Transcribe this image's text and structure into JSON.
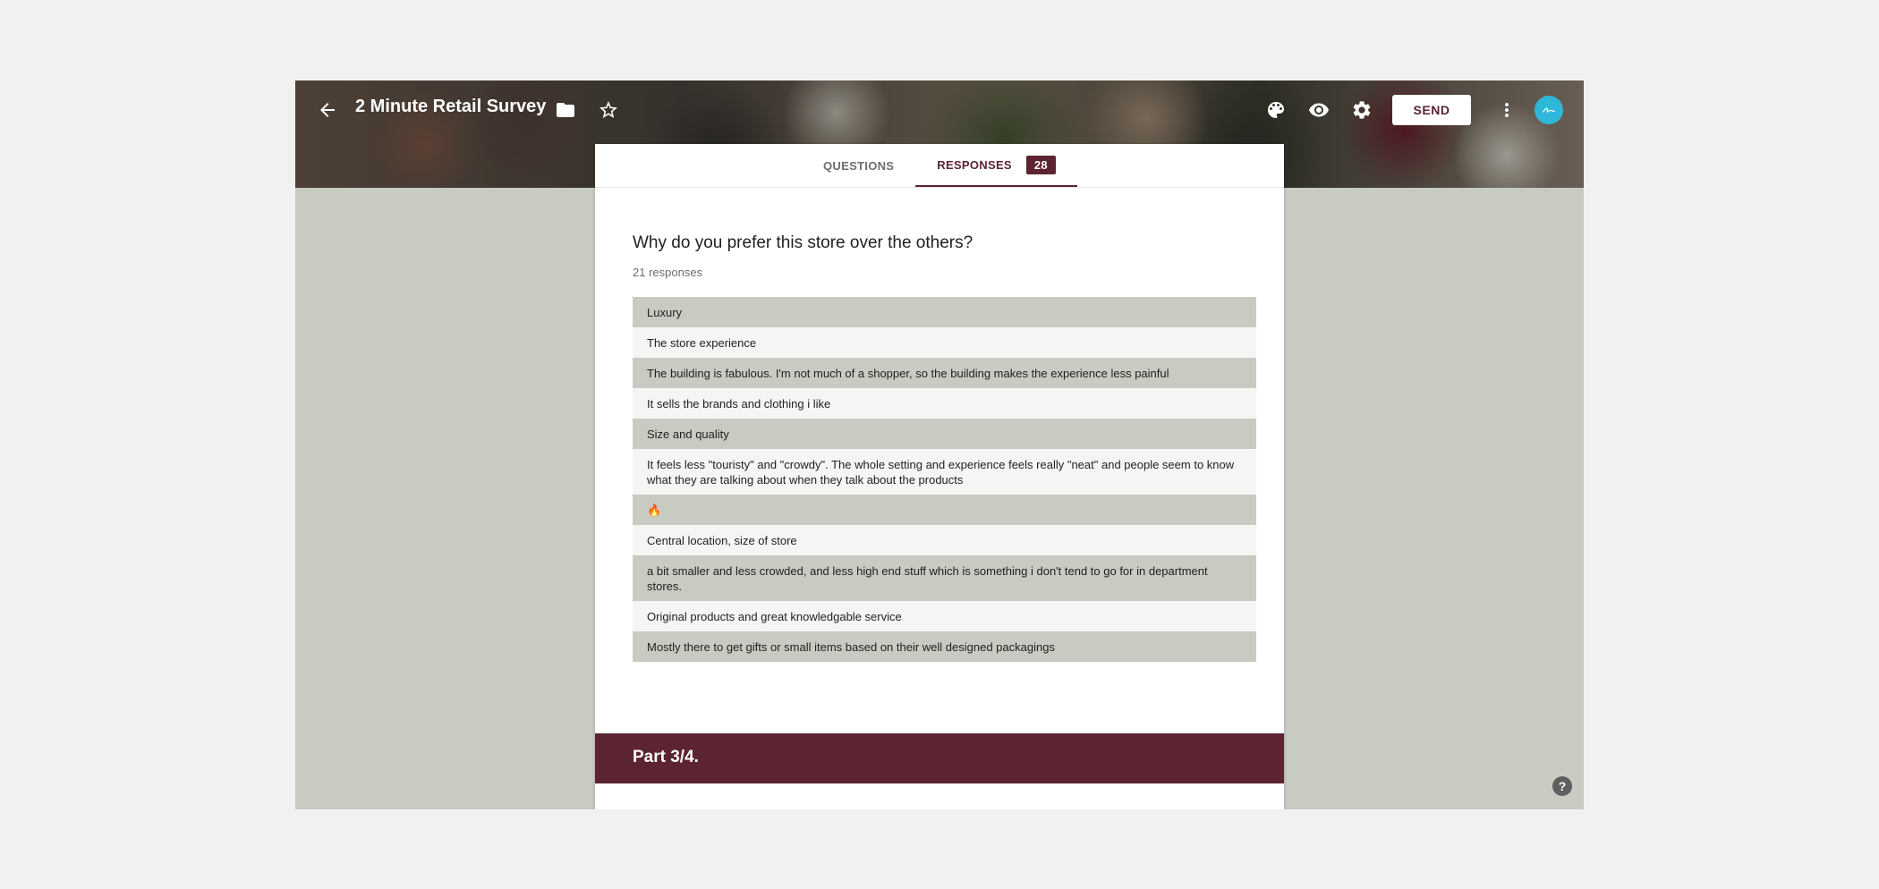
{
  "header": {
    "title": "2 Minute Retail Survey",
    "send_label": "SEND",
    "icons": [
      "back-arrow-icon",
      "folder-icon",
      "star-icon",
      "palette-icon",
      "eye-icon",
      "gear-icon",
      "more-vert-icon"
    ]
  },
  "tabs": {
    "questions_label": "QUESTIONS",
    "responses_label": "RESPONSES",
    "responses_count": "28"
  },
  "question": {
    "title": "Why do you prefer this store over the others?",
    "response_count": "21 responses"
  },
  "responses": [
    "Luxury",
    "The store experience",
    "The building is fabulous. I'm not much of a shopper, so the building makes the experience less painful",
    "It sells the brands and clothing i like",
    "Size and quality",
    "It feels less \"touristy\" and \"crowdy\". The whole setting and experience feels really \"neat\" and people seem to know what they are talking about when they talk about the products",
    "🔥",
    "Central location, size of store",
    "a bit smaller and less crowded, and less high end stuff which is something i don't tend to go for in department stores.",
    "Original products and great knowledgable service",
    "Mostly there to get gifts or small items based on their well designed packagings"
  ],
  "section": {
    "title": "Part 3/4."
  },
  "help": {
    "label": "?"
  },
  "colors": {
    "accent": "#5b2430",
    "background": "#c8cbc2",
    "avatar": "#2fb7d9"
  }
}
